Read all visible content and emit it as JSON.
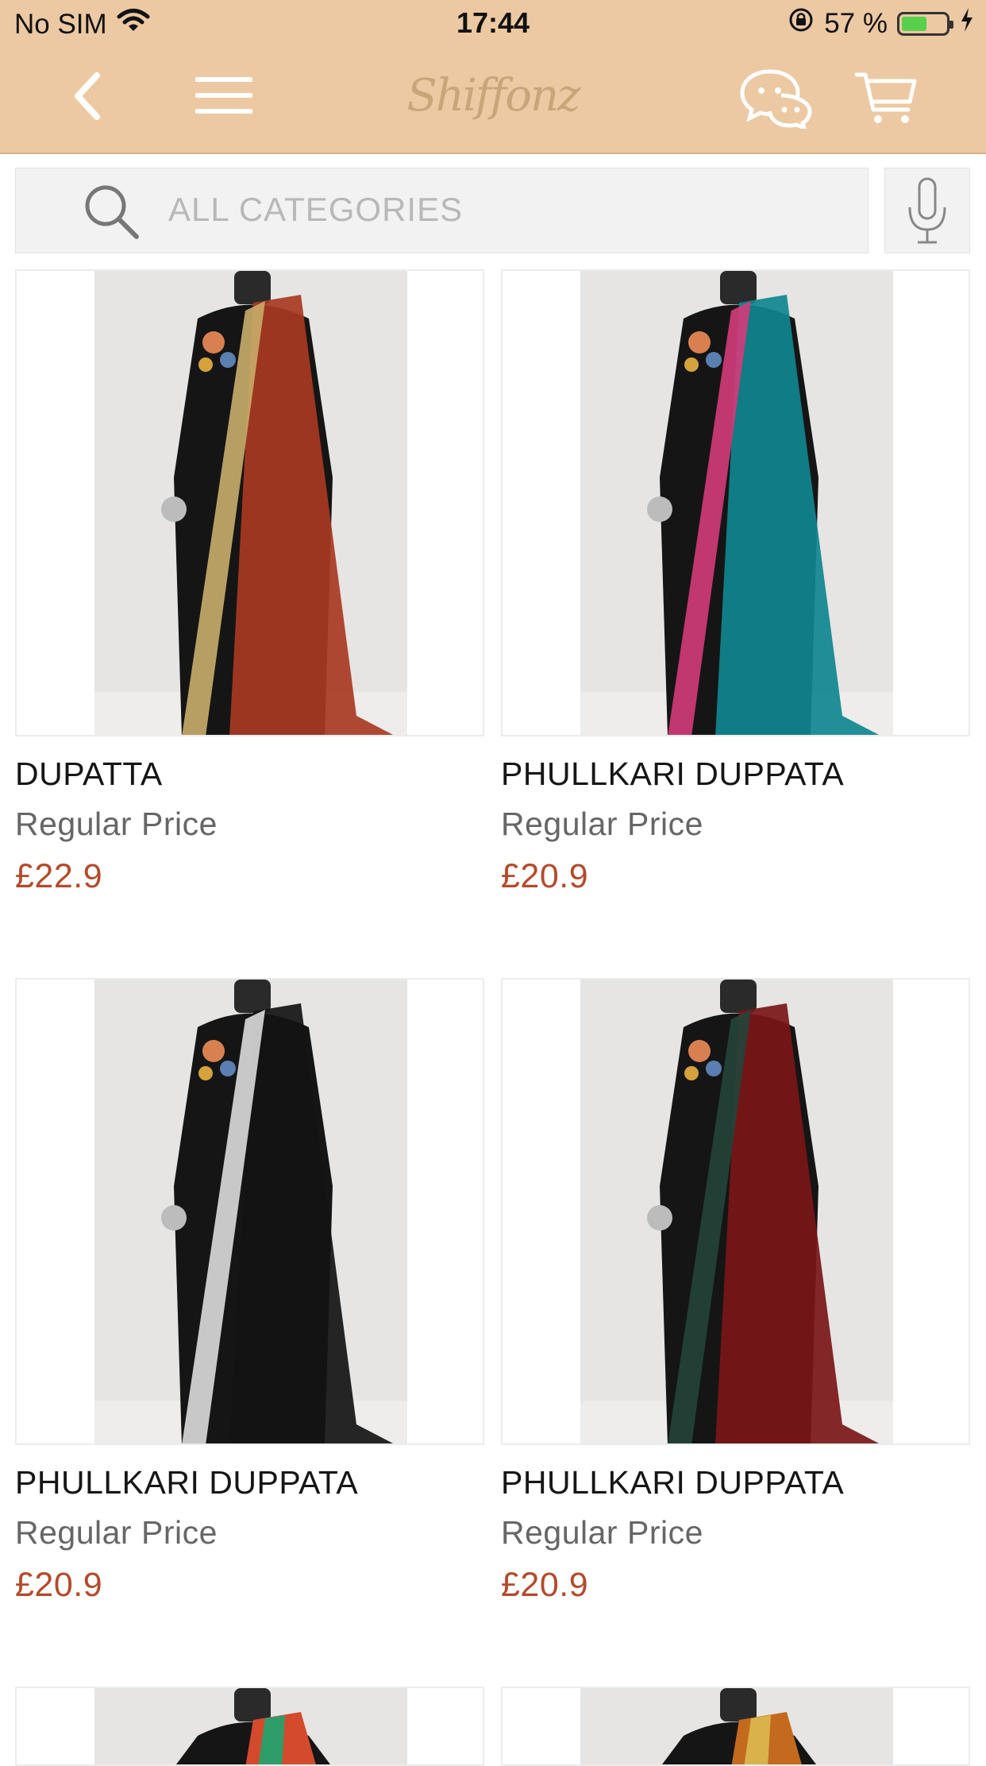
{
  "status_bar": {
    "carrier": "No SIM",
    "time": "17:44",
    "battery_percent": "57 %",
    "battery_level": 0.57
  },
  "navbar": {
    "logo_text": "Shiffonz",
    "icons": [
      "back-arrow-icon",
      "hamburger-menu-icon",
      "chat-icon",
      "cart-icon"
    ]
  },
  "search": {
    "placeholder": "ALL CATEGORIES"
  },
  "products": [
    {
      "name": "DUPATTA",
      "regular_label": "Regular Price",
      "price": "£22.9",
      "colors": [
        "#a93a22",
        "#c9ad6a"
      ]
    },
    {
      "name": "PHULLKARI DUPPATA",
      "regular_label": "Regular Price",
      "price": "£20.9",
      "colors": [
        "#10858f",
        "#d43b7a"
      ]
    },
    {
      "name": "PHULLKARI DUPPATA",
      "regular_label": "Regular Price",
      "price": "£20.9",
      "colors": [
        "#141414",
        "#dcdcdc"
      ]
    },
    {
      "name": "PHULLKARI DUPPATA",
      "regular_label": "Regular Price",
      "price": "£20.9",
      "colors": [
        "#7a1618",
        "#24443a"
      ]
    }
  ],
  "colors": {
    "header_bg": "#ecc9a2",
    "price_red": "#b44a2b",
    "battery_green": "#57d04b"
  }
}
